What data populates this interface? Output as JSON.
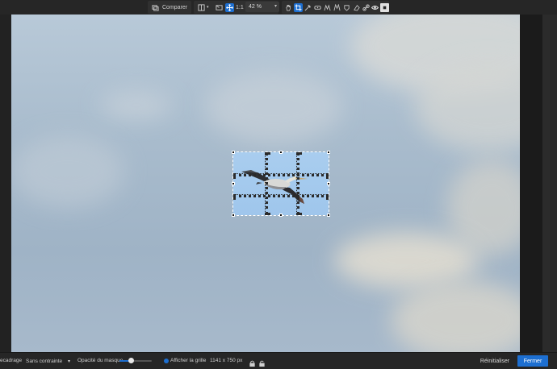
{
  "toolbar": {
    "compare_label": "Comparer",
    "one_to_one_label": "1:1",
    "zoom_value": "42 %",
    "icons": [
      "compare-icon",
      "split-view-icon",
      "mask-icon",
      "move-icon",
      "one-to-one",
      "hand-icon",
      "crop-icon",
      "eyedropper-icon",
      "heal-icon",
      "curves-icon",
      "local-adjust-icon",
      "brush-icon",
      "eraser-icon",
      "link-icon",
      "eye-icon",
      "view-mode-icon"
    ]
  },
  "crop": {
    "aspect_label": "Sans contrainte",
    "mask_opacity_label": "Opacité du masque",
    "mask_opacity_value": 0.35,
    "show_grid_label": "Afficher la grille",
    "show_grid_checked": true,
    "dimensions": "1141 x 750 px",
    "mode_label": "ecadrage"
  },
  "actions": {
    "reset_label": "Réinitialiser",
    "close_label": "Fermer"
  },
  "colors": {
    "accent": "#1d6fd1",
    "toolbar_bg": "#262626",
    "sky": "#a9bccd"
  }
}
